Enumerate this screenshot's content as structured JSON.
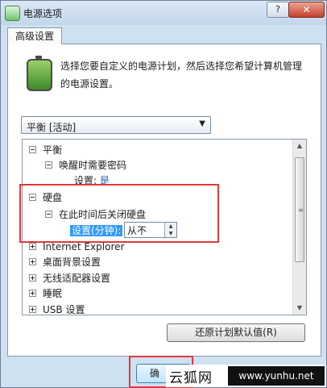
{
  "window": {
    "title": "电源选项",
    "help": "?",
    "close": "✕"
  },
  "tab": {
    "label": "高级设置"
  },
  "intro": {
    "text": "选择您要自定义的电源计划，然后选择您希望计算机管理的电源设置。"
  },
  "plan_select": {
    "value": "平衡 [活动]"
  },
  "tree": {
    "items": [
      {
        "label": "平衡",
        "toggle": "minus"
      },
      {
        "label": "唤醒时需要密码",
        "toggle": "minus"
      },
      {
        "label": "设置:",
        "value": "是"
      },
      {
        "label": "硬盘",
        "toggle": "minus"
      },
      {
        "label": "在此时间后关闭硬盘",
        "toggle": "minus"
      },
      {
        "label": "设置(分钟):",
        "value": "从不"
      },
      {
        "label": "Internet Explorer",
        "toggle": "plus"
      },
      {
        "label": "桌面背景设置",
        "toggle": "plus"
      },
      {
        "label": "无线适配器设置",
        "toggle": "plus"
      },
      {
        "label": "睡眠",
        "toggle": "plus"
      },
      {
        "label": "USB 设置",
        "toggle": "plus"
      }
    ]
  },
  "buttons": {
    "restore": "还原计划默认值(R)",
    "ok": "确"
  },
  "watermark": {
    "cn": "云狐网",
    "url": "www.yunhu.net"
  },
  "colors": {
    "highlight": "#e0393a",
    "selection": "#3399ff",
    "link": "#1c5bb0"
  }
}
